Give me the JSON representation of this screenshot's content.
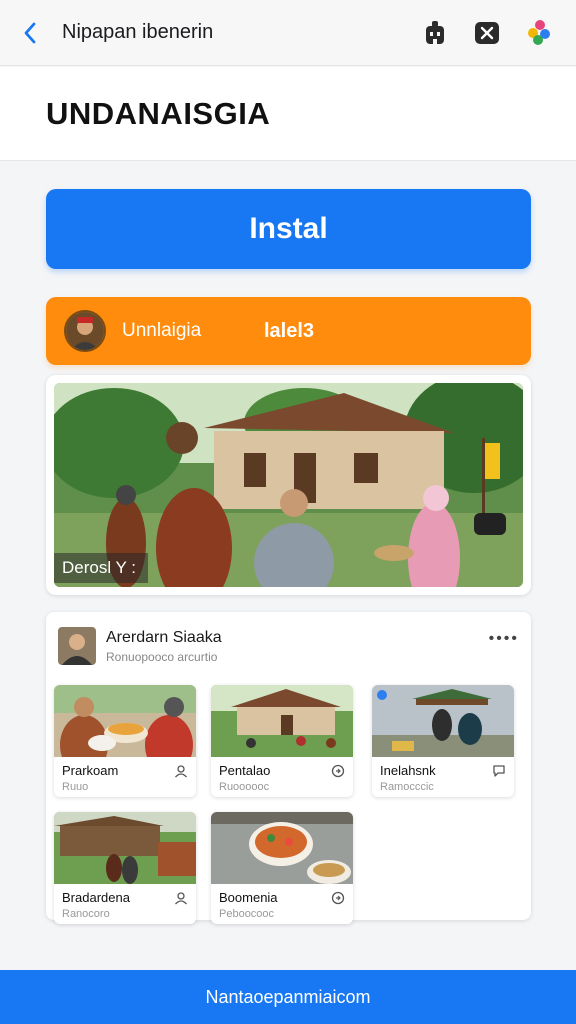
{
  "topbar": {
    "title": "Nipapan ibenerin",
    "icons": [
      "back-chevron-icon",
      "robot-icon",
      "close-icon",
      "colorful-app-icon"
    ]
  },
  "header": {
    "app_name": "UNDANAISGIA"
  },
  "install": {
    "label": "Instal"
  },
  "orange_bar": {
    "name": "Unnlaigia",
    "count": "lalel3"
  },
  "hero": {
    "caption": "Derosl Y :"
  },
  "feed": {
    "author": "Arerdarn Siaaka",
    "subtitle": "Ronuopooco arcurtio",
    "more": "••••",
    "tiles": [
      {
        "title": "Prarkoam",
        "subtitle": "Ruuo",
        "icon": "person-icon"
      },
      {
        "title": "Pentalao",
        "subtitle": "Ruoooooc",
        "icon": "share-icon"
      },
      {
        "title": "Inelahsnk",
        "subtitle": "Ramocccic",
        "icon": "chat-icon"
      },
      {
        "title": "Bradardena",
        "subtitle": "Ranocoro",
        "icon": "person-icon"
      },
      {
        "title": "Boomenia",
        "subtitle": "Peboocooc",
        "icon": "share-icon"
      }
    ]
  },
  "bottom_bar": {
    "text": "Nantaoepanmiaicom"
  },
  "colors": {
    "primary": "#1877f2",
    "orange": "#ff8c0d"
  }
}
